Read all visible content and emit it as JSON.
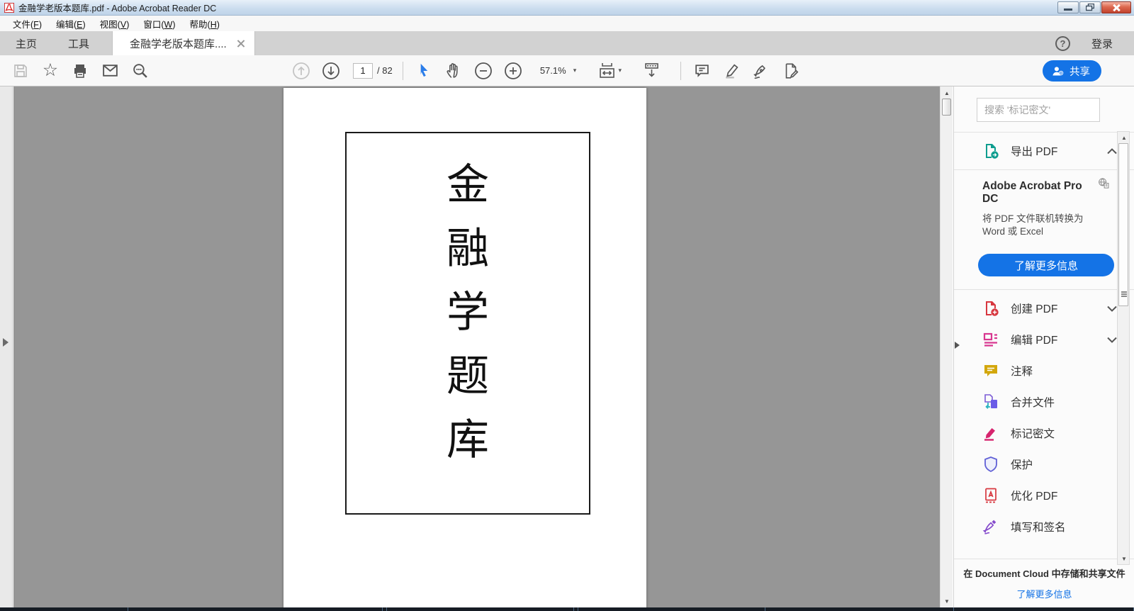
{
  "window": {
    "title": "金融学老版本题库.pdf - Adobe Acrobat Reader DC"
  },
  "menubar": {
    "items": [
      {
        "pre": "文件(",
        "key": "F",
        "post": ")"
      },
      {
        "pre": "编辑(",
        "key": "E",
        "post": ")"
      },
      {
        "pre": "视图(",
        "key": "V",
        "post": ")"
      },
      {
        "pre": "窗口(",
        "key": "W",
        "post": ")"
      },
      {
        "pre": "帮助(",
        "key": "H",
        "post": ")"
      }
    ]
  },
  "tabs": {
    "home": "主页",
    "tools": "工具",
    "document": "金融学老版本题库....",
    "help_glyph": "?",
    "login": "登录"
  },
  "toolbar": {
    "page_current": "1",
    "page_total": "/ 82",
    "zoom_level": "57.1%",
    "share_label": "共享"
  },
  "document": {
    "title_chars": [
      "金",
      "融",
      "学",
      "题",
      "库"
    ],
    "page_number_shown": "1",
    "total_pages": "82"
  },
  "sidebar": {
    "search_placeholder": "搜索 '标记密文'",
    "export_pdf_label": "导出 PDF",
    "promo": {
      "title": "Adobe Acrobat Pro DC",
      "description": "将 PDF 文件联机转换为 Word 或 Excel",
      "button": "了解更多信息"
    },
    "tools": [
      {
        "label": "创建 PDF"
      },
      {
        "label": "编辑 PDF"
      },
      {
        "label": "注释"
      },
      {
        "label": "合并文件"
      },
      {
        "label": "标记密文"
      },
      {
        "label": "保护"
      },
      {
        "label": "优化 PDF"
      },
      {
        "label": "填写和签名"
      }
    ],
    "footer": {
      "text": "在 Document Cloud 中存储和共享文件",
      "link": "了解更多信息"
    }
  },
  "colors": {
    "accent_blue": "#1473e6",
    "doc_background": "#969696",
    "export_teal": "#0f9d8f",
    "create_red": "#d7373f",
    "edit_magenta": "#d83790",
    "comment_yellow": "#d3a70c",
    "combine_purple": "#6b5ce7",
    "redact_pink": "#d6246e",
    "protect_indigo": "#6161d6",
    "fill_sign_purple": "#864ccc"
  }
}
